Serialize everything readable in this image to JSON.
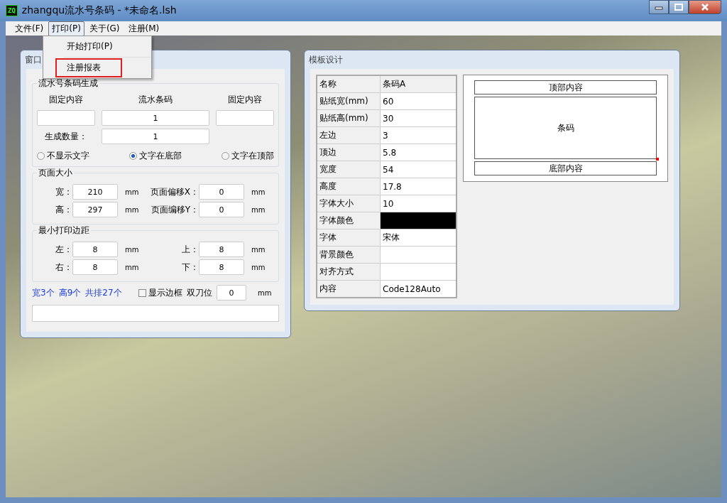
{
  "window": {
    "icon_text": "ZQ",
    "title": "zhangqu流水号条码 - *未命名.lsh"
  },
  "menu": [
    {
      "label": "文件(F)",
      "selected": false
    },
    {
      "label": "打印(P)",
      "selected": true
    },
    {
      "label": "关于(G)",
      "selected": false
    },
    {
      "label": "注册(M)",
      "selected": false
    }
  ],
  "dropdown": [
    {
      "label": "开始打印(P)",
      "highlighted": false
    },
    {
      "label": "注册报表",
      "highlighted": true
    }
  ],
  "left_window": {
    "title": "窗口",
    "serial": {
      "title": "流水号条码生成",
      "headers": [
        "固定内容",
        "流水条码",
        "固定内容"
      ],
      "start_value": "1",
      "count_label": "生成数量：",
      "count_value": "1",
      "text_position": [
        {
          "label": "不显示文字",
          "selected": false
        },
        {
          "label": "文字在底部",
          "selected": true
        },
        {
          "label": "文字在顶部",
          "selected": false
        }
      ]
    },
    "page_size": {
      "title": "页面大小",
      "rows": [
        {
          "label": "宽：",
          "value": "210",
          "unit": "mm",
          "label2": "页面偏移X：",
          "value2": "0",
          "unit2": "mm"
        },
        {
          "label": "高：",
          "value": "297",
          "unit": "mm",
          "label2": "页面编移Y：",
          "value2": "0",
          "unit2": "mm"
        }
      ]
    },
    "margins": {
      "title": "最小打印边距",
      "rows": [
        {
          "label": "左：",
          "value": "8",
          "unit": "mm",
          "label2": "上：",
          "value2": "8",
          "unit2": "mm"
        },
        {
          "label": "右：",
          "value": "8",
          "unit": "mm",
          "label2": "下：",
          "value2": "8",
          "unit2": "mm"
        }
      ]
    },
    "summary": {
      "links": [
        "宽3个",
        "高9个",
        "共排27个"
      ],
      "show_border": {
        "label": "显示边框",
        "checked": false
      },
      "blade_label": "双刀位",
      "blade_value": "0",
      "blade_unit": "mm"
    }
  },
  "right_window": {
    "title": "模板设计",
    "properties": [
      {
        "name": "名称",
        "value": "条码A",
        "kind": "text"
      },
      {
        "name": "贴纸宽(mm)",
        "value": "60",
        "kind": "text"
      },
      {
        "name": "贴纸高(mm)",
        "value": "30",
        "kind": "text"
      },
      {
        "name": "左边",
        "value": "3",
        "kind": "text"
      },
      {
        "name": "顶边",
        "value": "5.8",
        "kind": "text"
      },
      {
        "name": "宽度",
        "value": "54",
        "kind": "text"
      },
      {
        "name": "高度",
        "value": "17.8",
        "kind": "text"
      },
      {
        "name": "字体大小",
        "value": "10",
        "kind": "text"
      },
      {
        "name": "字体颜色",
        "kind": "color",
        "color": "#000000"
      },
      {
        "name": "字体",
        "value": "宋体",
        "kind": "text"
      },
      {
        "name": "背景颜色",
        "kind": "text"
      },
      {
        "name": "对齐方式",
        "kind": "text"
      },
      {
        "name": "内容",
        "value": "Code128Auto",
        "kind": "text"
      }
    ],
    "preview": {
      "top": "顶部内容",
      "barcode": "条码",
      "bottom": "底部内容"
    }
  }
}
